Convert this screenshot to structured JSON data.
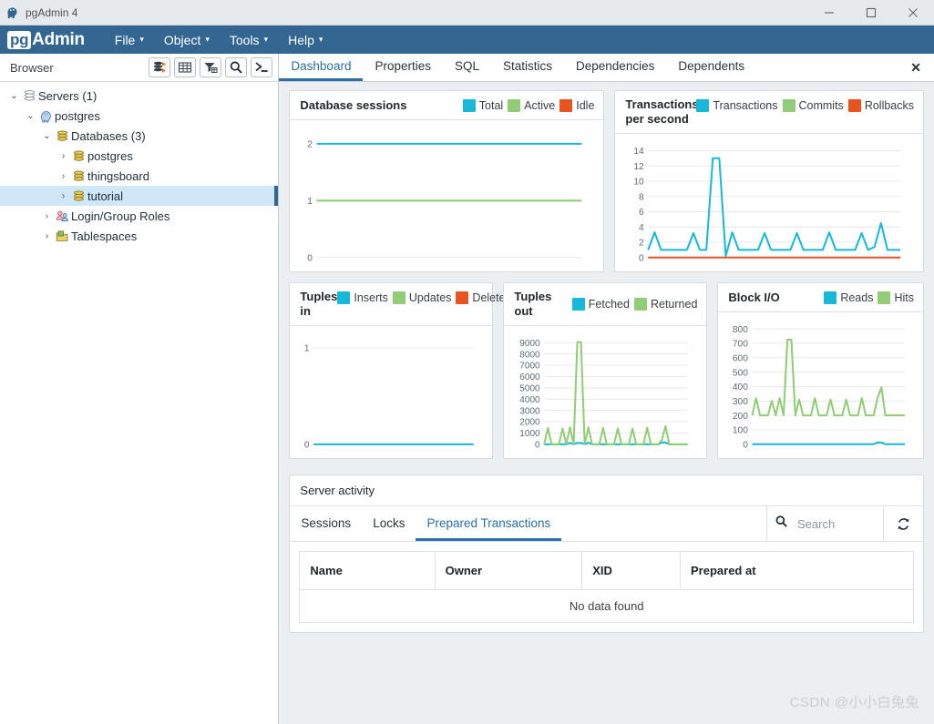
{
  "window": {
    "title": "pgAdmin 4",
    "app_icon": "elephant-icon",
    "minimize_label": "—",
    "maximize_label": "☐",
    "close_label": "✕"
  },
  "menubar": {
    "logo_pg": "pg",
    "logo_admin": "Admin",
    "items": [
      {
        "label": "File",
        "caret": "▾"
      },
      {
        "label": "Object",
        "caret": "▾"
      },
      {
        "label": "Tools",
        "caret": "▾"
      },
      {
        "label": "Help",
        "caret": "▾"
      }
    ]
  },
  "browser": {
    "title": "Browser",
    "tools": [
      {
        "name": "add-server-icon"
      },
      {
        "name": "grid-view-icon"
      },
      {
        "name": "filter-icon"
      },
      {
        "name": "search-icon"
      },
      {
        "name": "query-tool-icon"
      }
    ],
    "tree": [
      {
        "label": "Servers (1)",
        "depth": 0,
        "twist": "⌄",
        "icon": "servers-icon",
        "selected": false
      },
      {
        "label": "postgres",
        "depth": 1,
        "twist": "⌄",
        "icon": "postgres-server-icon",
        "selected": false
      },
      {
        "label": "Databases (3)",
        "depth": 2,
        "twist": "⌄",
        "icon": "databases-icon",
        "selected": false
      },
      {
        "label": "postgres",
        "depth": 3,
        "twist": "›",
        "icon": "database-icon",
        "selected": false
      },
      {
        "label": "thingsboard",
        "depth": 3,
        "twist": "›",
        "icon": "database-icon",
        "selected": false
      },
      {
        "label": "tutorial",
        "depth": 3,
        "twist": "›",
        "icon": "database-icon",
        "selected": true
      },
      {
        "label": "Login/Group Roles",
        "depth": 2,
        "twist": "›",
        "icon": "roles-icon",
        "selected": false
      },
      {
        "label": "Tablespaces",
        "depth": 2,
        "twist": "›",
        "icon": "tablespaces-icon",
        "selected": false
      }
    ]
  },
  "tabs": {
    "items": [
      {
        "label": "Dashboard",
        "active": true
      },
      {
        "label": "Properties",
        "active": false
      },
      {
        "label": "SQL",
        "active": false
      },
      {
        "label": "Statistics",
        "active": false
      },
      {
        "label": "Dependencies",
        "active": false
      },
      {
        "label": "Dependents",
        "active": false
      }
    ],
    "close_label": "✕"
  },
  "colors": {
    "total": "#1ab8d8",
    "active": "#92cc76",
    "idle": "#e8541f",
    "accent": "#2c6fa6",
    "brand": "#336791",
    "selection": "#cfe8f8"
  },
  "chart_data": [
    {
      "id": "database-sessions",
      "type": "line",
      "title": "Database sessions",
      "legend": [
        {
          "name": "Total",
          "color": "#1ab8d8"
        },
        {
          "name": "Active",
          "color": "#92cc76"
        },
        {
          "name": "Idle",
          "color": "#e8541f"
        }
      ],
      "ylabel": "",
      "xlabel": "",
      "yticks": [
        0,
        1,
        2
      ],
      "ylim": [
        0,
        2.2
      ],
      "grid": true,
      "legend_position": "top-right",
      "series": [
        {
          "name": "Total",
          "color": "#1ab8d8",
          "values": [
            2,
            2,
            2,
            2,
            2,
            2,
            2,
            2,
            2,
            2,
            2,
            2,
            2,
            2,
            2,
            2,
            2,
            2,
            2,
            2,
            2,
            2,
            2,
            2,
            2,
            2,
            2,
            2,
            2,
            2,
            2,
            2,
            2,
            2,
            2,
            2,
            2,
            2,
            2,
            2
          ]
        },
        {
          "name": "Active",
          "color": "#92cc76",
          "values": [
            1,
            1,
            1,
            1,
            1,
            1,
            1,
            1,
            1,
            1,
            1,
            1,
            1,
            1,
            1,
            1,
            1,
            1,
            1,
            1,
            1,
            1,
            1,
            1,
            1,
            1,
            1,
            1,
            1,
            1,
            1,
            1,
            1,
            1,
            1,
            1,
            1,
            1,
            1,
            1
          ]
        },
        {
          "name": "Idle",
          "color": "#e8541f",
          "values": []
        }
      ]
    },
    {
      "id": "transactions-per-second",
      "type": "line",
      "title": "Transactions per second",
      "legend": [
        {
          "name": "Transactions",
          "color": "#1ab8d8"
        },
        {
          "name": "Commits",
          "color": "#92cc76"
        },
        {
          "name": "Rollbacks",
          "color": "#e8541f"
        }
      ],
      "ylabel": "",
      "xlabel": "",
      "yticks": [
        0,
        2,
        4,
        6,
        8,
        10,
        12,
        14
      ],
      "ylim": [
        0,
        14.6
      ],
      "grid": true,
      "legend_position": "top-right",
      "series": [
        {
          "name": "Transactions",
          "color": "#1ab8d8",
          "values": [
            1,
            3.3,
            1,
            1,
            1,
            1,
            1,
            3.2,
            1,
            1,
            13,
            13,
            0.2,
            3.3,
            1,
            1,
            1,
            1,
            3.2,
            1,
            1,
            1,
            1,
            3.2,
            1,
            1,
            1,
            1,
            3.3,
            1,
            1,
            1,
            1,
            3.2,
            1,
            1.4,
            4.5,
            1,
            1,
            1
          ]
        },
        {
          "name": "Commits",
          "color": "#92cc76",
          "values": []
        },
        {
          "name": "Rollbacks",
          "color": "#e8541f",
          "values": [
            0,
            0,
            0,
            0,
            0,
            0,
            0,
            0,
            0,
            0,
            0,
            0,
            0,
            0,
            0,
            0,
            0,
            0,
            0,
            0,
            0,
            0,
            0,
            0,
            0,
            0,
            0,
            0,
            0,
            0,
            0,
            0,
            0,
            0,
            0,
            0,
            0,
            0,
            0,
            0
          ]
        }
      ]
    },
    {
      "id": "tuples-in",
      "type": "line",
      "title": "Tuples in",
      "legend": [
        {
          "name": "Inserts",
          "color": "#1ab8d8"
        },
        {
          "name": "Updates",
          "color": "#92cc76"
        },
        {
          "name": "Deletes",
          "color": "#e8541f"
        }
      ],
      "ylabel": "",
      "xlabel": "",
      "yticks": [
        0,
        1
      ],
      "ylim": [
        0,
        1.1
      ],
      "grid": true,
      "legend_position": "top-right",
      "series": [
        {
          "name": "Inserts",
          "color": "#1ab8d8",
          "values": [
            0,
            0,
            0,
            0,
            0,
            0,
            0,
            0,
            0,
            0,
            0,
            0,
            0,
            0,
            0,
            0,
            0,
            0,
            0,
            0,
            0,
            0,
            0,
            0,
            0,
            0,
            0,
            0,
            0,
            0,
            0,
            0,
            0,
            0,
            0,
            0,
            0,
            0,
            0,
            0
          ]
        },
        {
          "name": "Updates",
          "color": "#92cc76",
          "values": []
        },
        {
          "name": "Deletes",
          "color": "#e8541f",
          "values": []
        }
      ]
    },
    {
      "id": "tuples-out",
      "type": "line",
      "title": "Tuples out",
      "legend": [
        {
          "name": "Fetched",
          "color": "#1ab8d8"
        },
        {
          "name": "Returned",
          "color": "#92cc76"
        }
      ],
      "ylabel": "",
      "xlabel": "",
      "yticks": [
        0,
        1000,
        2000,
        3000,
        4000,
        5000,
        6000,
        7000,
        8000,
        9000
      ],
      "ylim": [
        0,
        9400
      ],
      "grid": true,
      "legend_position": "top-right",
      "series": [
        {
          "name": "Returned",
          "color": "#92cc76",
          "values": [
            0,
            1450,
            0,
            0,
            0,
            1400,
            0,
            1500,
            0,
            9050,
            9050,
            0,
            1500,
            0,
            0,
            0,
            1450,
            0,
            0,
            0,
            1400,
            0,
            0,
            0,
            1400,
            0,
            0,
            0,
            1480,
            0,
            0,
            0,
            400,
            1600,
            0,
            0,
            0,
            0,
            0,
            0
          ]
        },
        {
          "name": "Fetched",
          "color": "#1ab8d8",
          "values": [
            0,
            0,
            0,
            0,
            0,
            0,
            0,
            120,
            0,
            120,
            120,
            0,
            140,
            0,
            0,
            0,
            0,
            0,
            0,
            0,
            0,
            0,
            0,
            0,
            0,
            0,
            0,
            0,
            0,
            0,
            0,
            0,
            160,
            160,
            0,
            0,
            0,
            0,
            0,
            0
          ]
        }
      ]
    },
    {
      "id": "block-io",
      "type": "line",
      "title": "Block I/O",
      "legend": [
        {
          "name": "Reads",
          "color": "#1ab8d8"
        },
        {
          "name": "Hits",
          "color": "#92cc76"
        }
      ],
      "ylabel": "",
      "xlabel": "",
      "yticks": [
        0,
        100,
        200,
        300,
        400,
        500,
        600,
        700,
        800
      ],
      "ylim": [
        0,
        830
      ],
      "grid": true,
      "legend_position": "top-right",
      "series": [
        {
          "name": "Hits",
          "color": "#92cc76",
          "values": [
            200,
            320,
            200,
            200,
            200,
            300,
            200,
            320,
            200,
            725,
            725,
            200,
            310,
            200,
            200,
            200,
            320,
            200,
            200,
            200,
            310,
            200,
            200,
            200,
            310,
            200,
            200,
            200,
            320,
            200,
            200,
            200,
            320,
            395,
            200,
            200,
            200,
            200,
            200,
            200
          ]
        },
        {
          "name": "Reads",
          "color": "#1ab8d8",
          "values": [
            0,
            0,
            0,
            0,
            0,
            0,
            0,
            0,
            0,
            0,
            0,
            0,
            0,
            0,
            0,
            0,
            0,
            0,
            0,
            0,
            0,
            0,
            0,
            0,
            0,
            0,
            0,
            0,
            0,
            0,
            0,
            0,
            12,
            12,
            0,
            0,
            0,
            0,
            0,
            0
          ]
        }
      ]
    }
  ],
  "server_activity": {
    "title": "Server activity",
    "tabs": [
      {
        "label": "Sessions",
        "active": false
      },
      {
        "label": "Locks",
        "active": false
      },
      {
        "label": "Prepared Transactions",
        "active": true
      }
    ],
    "search_placeholder": "Search",
    "search_value": "",
    "search_icon": "search-icon",
    "refresh_icon": "refresh-icon",
    "table": {
      "columns": [
        "Name",
        "Owner",
        "XID",
        "Prepared at"
      ],
      "rows": [],
      "empty_text": "No data found"
    }
  },
  "watermark": "CSDN @小小白兔兔"
}
